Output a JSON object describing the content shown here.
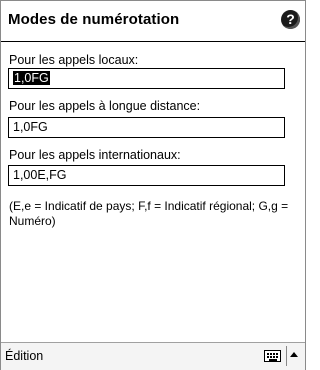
{
  "header": {
    "title": "Modes de numérotation",
    "help_glyph": "?"
  },
  "fields": {
    "local": {
      "label": "Pour les appels locaux:",
      "value": "1,0FG",
      "selected": true
    },
    "long_distance": {
      "label": "Pour les appels à longue distance:",
      "value": "1,0FG"
    },
    "international": {
      "label": "Pour les appels internationaux:",
      "value": "1,00E,FG"
    }
  },
  "note": "(E,e = Indicatif de pays; F,f = Indicatif régional; G,g = Numéro)",
  "bottombar": {
    "menu_label": "Édition",
    "keyboard_icon": "keyboard-icon",
    "sip_arrow_icon": "up-arrow-icon"
  },
  "colors": {
    "selection": "#000000",
    "border": "#000000",
    "bar_bg": "#f4f4f4"
  }
}
